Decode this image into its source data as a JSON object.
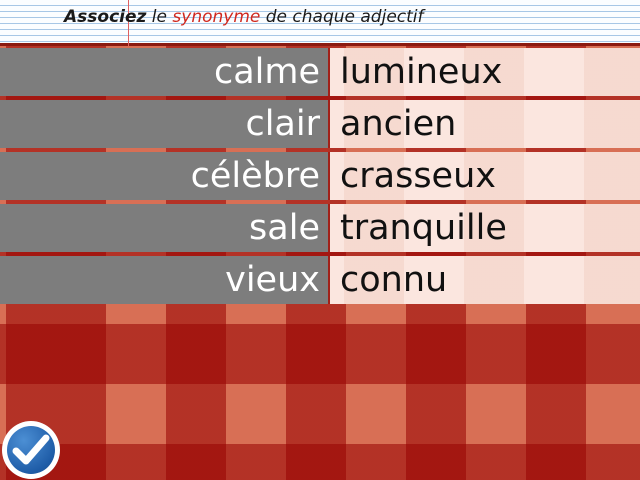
{
  "instruction": {
    "bold": "Associez",
    "part1": " le ",
    "highlight": "synonyme",
    "part2": " de chaque adjectif"
  },
  "pairs": [
    {
      "left": "calme",
      "right": "lumineux"
    },
    {
      "left": "clair",
      "right": "ancien"
    },
    {
      "left": "célèbre",
      "right": "crasseux"
    },
    {
      "left": "sale",
      "right": "tranquille"
    },
    {
      "left": "vieux",
      "right": "connu"
    }
  ],
  "colors": {
    "left_cell": "#7d7d7d",
    "right_cell": "#fbe6df",
    "highlight": "#d0281e",
    "check_button": "#1f5da8"
  },
  "icons": {
    "validate": "checkmark-icon"
  }
}
